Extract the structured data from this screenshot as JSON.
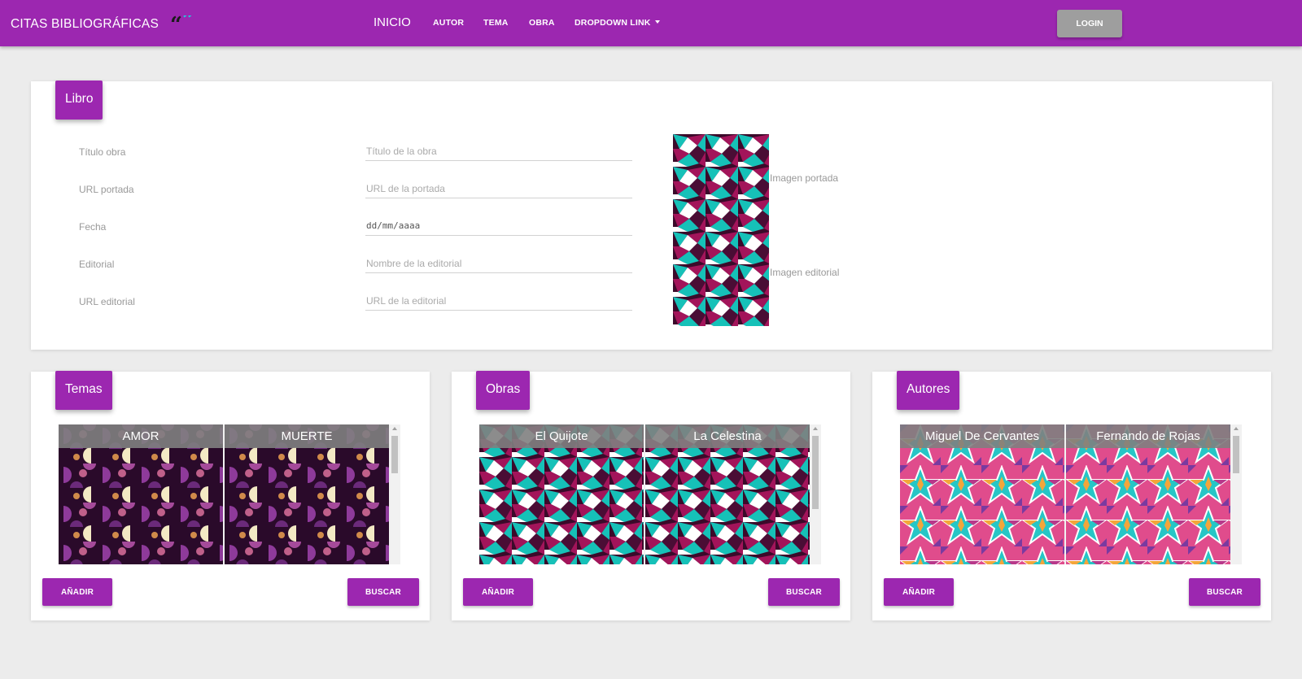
{
  "navbar": {
    "brand": "CITAS BIBLIOGRÁFICAS",
    "inicio": "INICIO",
    "autor": "AUTOR",
    "tema": "TEMA",
    "obra": "OBRA",
    "dropdown": "DROPDOWN LINK",
    "login": "LOGIN"
  },
  "libro": {
    "header": "Libro",
    "fields": [
      {
        "label": "Título obra",
        "placeholder": "Título de la obra"
      },
      {
        "label": "URL portada",
        "placeholder": "URL de la portada"
      },
      {
        "label": "Fecha",
        "value": "dd/mm/aaaa"
      },
      {
        "label": "Editorial",
        "placeholder": "Nombre de la editorial"
      },
      {
        "label": "URL editorial",
        "placeholder": "URL de la editorial"
      }
    ],
    "img_portada": "Imagen portada",
    "img_editorial": "Imagen editorial"
  },
  "temas": {
    "header": "Temas",
    "items": [
      "AMOR",
      "MUERTE"
    ],
    "add": "AÑADIR",
    "search": "BUSCAR"
  },
  "obras": {
    "header": "Obras",
    "items": [
      "El Quijote",
      "La Celestina"
    ],
    "add": "AÑADIR",
    "search": "BUSCAR"
  },
  "autores": {
    "header": "Autores",
    "items": [
      "Miguel De Cervantes",
      "Fernando de Rojas"
    ],
    "add": "AÑADIR",
    "search": "BUSCAR"
  },
  "colors": {
    "primary": "#9c27b0",
    "login_bg": "#9e9e9e",
    "page_bg": "#ececec"
  }
}
